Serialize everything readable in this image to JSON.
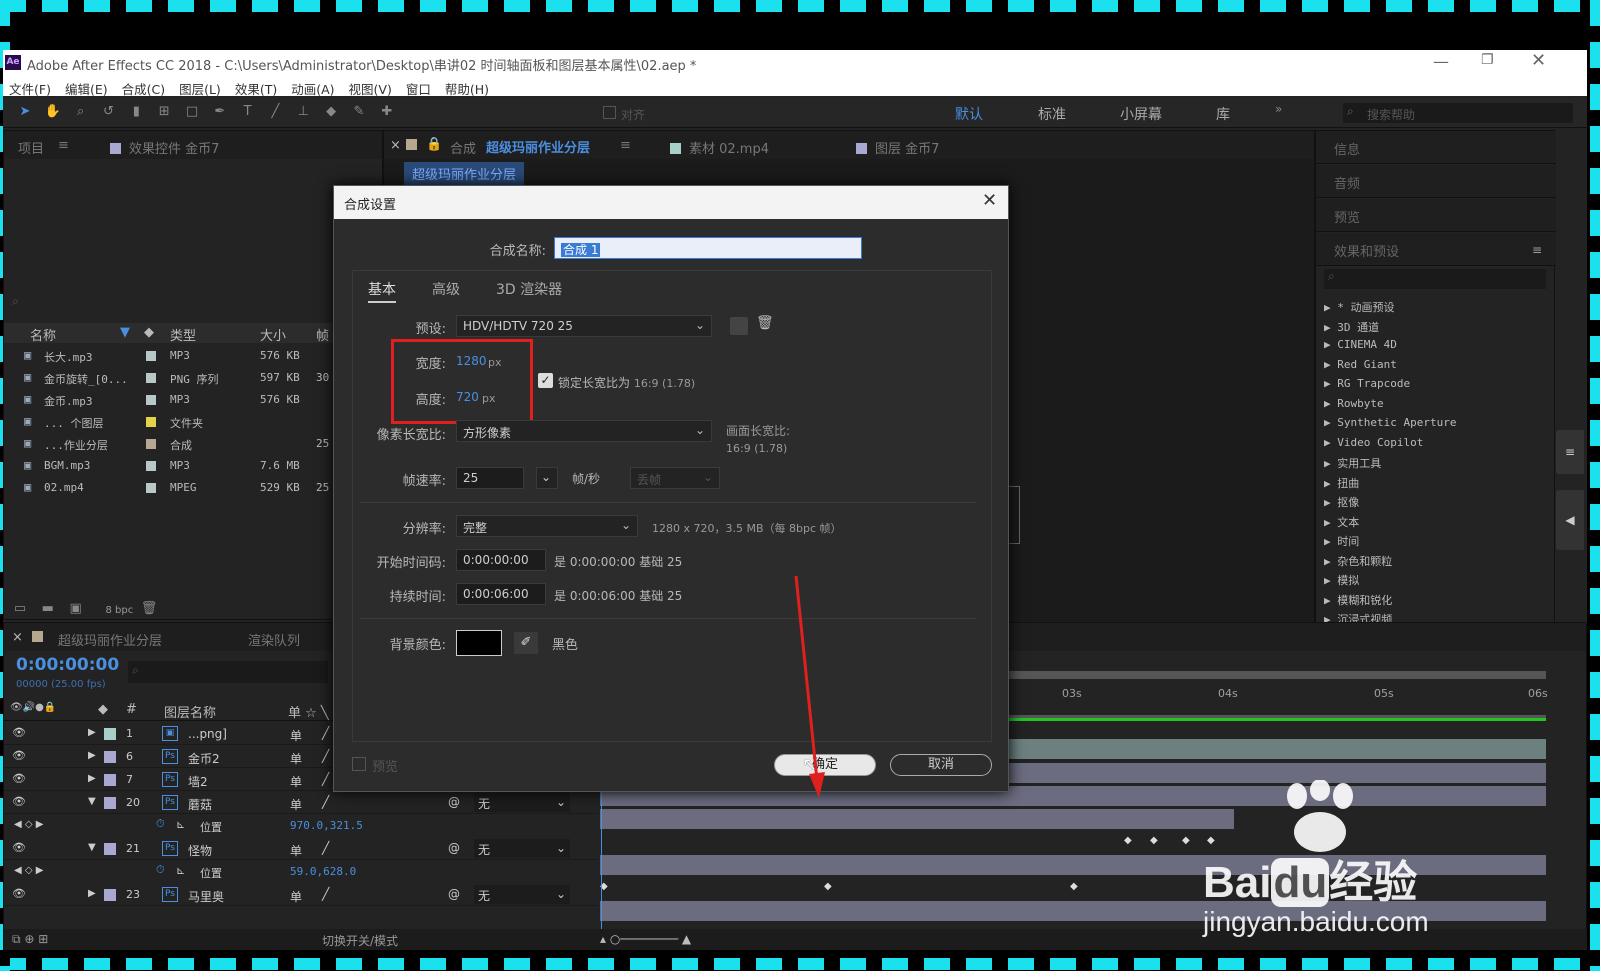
{
  "window": {
    "title": "Adobe After Effects CC 2018 - C:\\Users\\Administrator\\Desktop\\串讲02  时间轴面板和图层基本属性\\02.aep *",
    "logo": "Ae"
  },
  "menu": [
    "文件(F)",
    "编辑(E)",
    "合成(C)",
    "图层(L)",
    "效果(T)",
    "动画(A)",
    "视图(V)",
    "窗口",
    "帮助(H)"
  ],
  "toolbar": {
    "snap_label": "对齐",
    "workspaces": [
      "默认",
      "标准",
      "小屏幕",
      "库"
    ],
    "search_placeholder": "搜索帮助"
  },
  "project_panel": {
    "tab_project": "项目",
    "tab_effects": "效果控件 金币7",
    "columns": [
      "名称",
      "类型",
      "大小",
      "帧"
    ],
    "items": [
      {
        "name": "长大.mp3",
        "color": "#b8c8c8",
        "type": "MP3",
        "size": "576 KB",
        "fr": ""
      },
      {
        "name": "金币旋转_[0...",
        "color": "#b8c8c8",
        "type": "PNG 序列",
        "size": "597 KB",
        "fr": "30"
      },
      {
        "name": "金币.mp3",
        "color": "#b8c8c8",
        "type": "MP3",
        "size": "576 KB",
        "fr": ""
      },
      {
        "name": "... 个图层",
        "color": "#e6d24a",
        "type": "文件夹",
        "size": "",
        "fr": ""
      },
      {
        "name": "...作业分层",
        "color": "#b6a890",
        "type": "合成",
        "size": "",
        "fr": "25"
      },
      {
        "name": "BGM.mp3",
        "color": "#b8c8c8",
        "type": "MP3",
        "size": "7.6 MB",
        "fr": ""
      },
      {
        "name": "02.mp4",
        "color": "#b8c8c8",
        "type": "MPEG",
        "size": "529 KB",
        "fr": "25"
      }
    ],
    "bpc": "8 bpc"
  },
  "comp_tabs": {
    "comp_prefix": "合成",
    "comp_name": "超级玛丽作业分层",
    "footage": "素材 02.mp4",
    "layer": "图层 金币7",
    "subtab": "超级玛丽作业分层"
  },
  "right_panel": {
    "sections": [
      "信息",
      "音频",
      "预览",
      "效果和预设"
    ],
    "effects": [
      "▶ * 动画预设",
      "▶ 3D 通道",
      "▶ CINEMA 4D",
      "▶ Red Giant",
      "▶ RG Trapcode",
      "▶ Rowbyte",
      "▶ Synthetic Aperture",
      "▶ Video Copilot",
      "▶ 实用工具",
      "▶ 扭曲",
      "▶ 抠像",
      "▶ 文本",
      "▶ 时间",
      "▶ 杂色和颗粒",
      "▶ 模拟",
      "▶ 模糊和锐化",
      "▶ 沉浸式视频"
    ]
  },
  "timeline": {
    "tab": "超级玛丽作业分层",
    "render_tab": "渲染队列",
    "timecode": "0:00:00:00",
    "fps": "00000 (25.00 fps)",
    "layer_col": "图层名称",
    "ruler": [
      "03s",
      "04s",
      "05s",
      "06s"
    ],
    "layers": [
      {
        "num": "1",
        "name": "...png]",
        "color": "#a8d0c8",
        "icon": "img",
        "parent": ""
      },
      {
        "num": "6",
        "name": "金币2",
        "color": "#a8a8d0",
        "icon": "Ps",
        "parent": ""
      },
      {
        "num": "7",
        "name": "墙2",
        "color": "#a8a8d0",
        "icon": "Ps",
        "parent": ""
      },
      {
        "num": "20",
        "name": "蘑菇",
        "color": "#a8a8d0",
        "icon": "Ps",
        "parent": "无",
        "prop": "位置",
        "value": "970.0,321.5"
      },
      {
        "num": "21",
        "name": "怪物",
        "color": "#a8a8d0",
        "icon": "Ps",
        "parent": "无",
        "prop": "位置",
        "value": "59.0,628.0"
      },
      {
        "num": "23",
        "name": "马里奥",
        "color": "#a8a8d0",
        "icon": "Ps",
        "parent": "无"
      }
    ],
    "toggle_label": "切换开关/模式",
    "switch_glyph": "单"
  },
  "dialog": {
    "title": "合成设置",
    "name_label": "合成名称:",
    "name_value": "合成 1",
    "tabs": [
      "基本",
      "高级",
      "3D 渲染器"
    ],
    "preset_label": "预设:",
    "preset_value": "HDV/HDTV 720 25",
    "width_label": "宽度:",
    "width_value": "1280",
    "height_label": "高度:",
    "height_value": "720",
    "px": "px",
    "lock_label": "锁定长宽比为",
    "lock_ratio": "16:9 (1.78)",
    "par_label": "像素长宽比:",
    "par_value": "方形像素",
    "frame_ar_label": "画面长宽比:",
    "frame_ar_value": "16:9 (1.78)",
    "fps_label": "帧速率:",
    "fps_value": "25",
    "fps_unit": "帧/秒",
    "drop_frame": "丢帧",
    "res_label": "分辨率:",
    "res_value": "完整",
    "res_info": "1280 x 720，3.5 MB（每 8bpc 帧）",
    "start_label": "开始时间码:",
    "start_value": "0:00:00:00",
    "start_info": "是 0:00:00:00",
    "base": "基础 25",
    "dur_label": "持续时间:",
    "dur_value": "0:00:06:00",
    "dur_info": "是 0:00:06:00",
    "bg_label": "背景颜色:",
    "bg_color": "#000000",
    "bg_name": "黑色",
    "preview_label": "预览",
    "ok": "确定",
    "cancel": "取消"
  },
  "watermark": {
    "brand_a": "Bai",
    "brand_b": "du",
    "brand_c": "经验",
    "url": "jingyan.baidu.com"
  },
  "colors": {
    "accent": "#4a8fe0",
    "highlight_box": "#e0201e",
    "arrow": "#e0201e",
    "frame_dash": "#1be0ee",
    "timeline_green": "#22c322"
  }
}
